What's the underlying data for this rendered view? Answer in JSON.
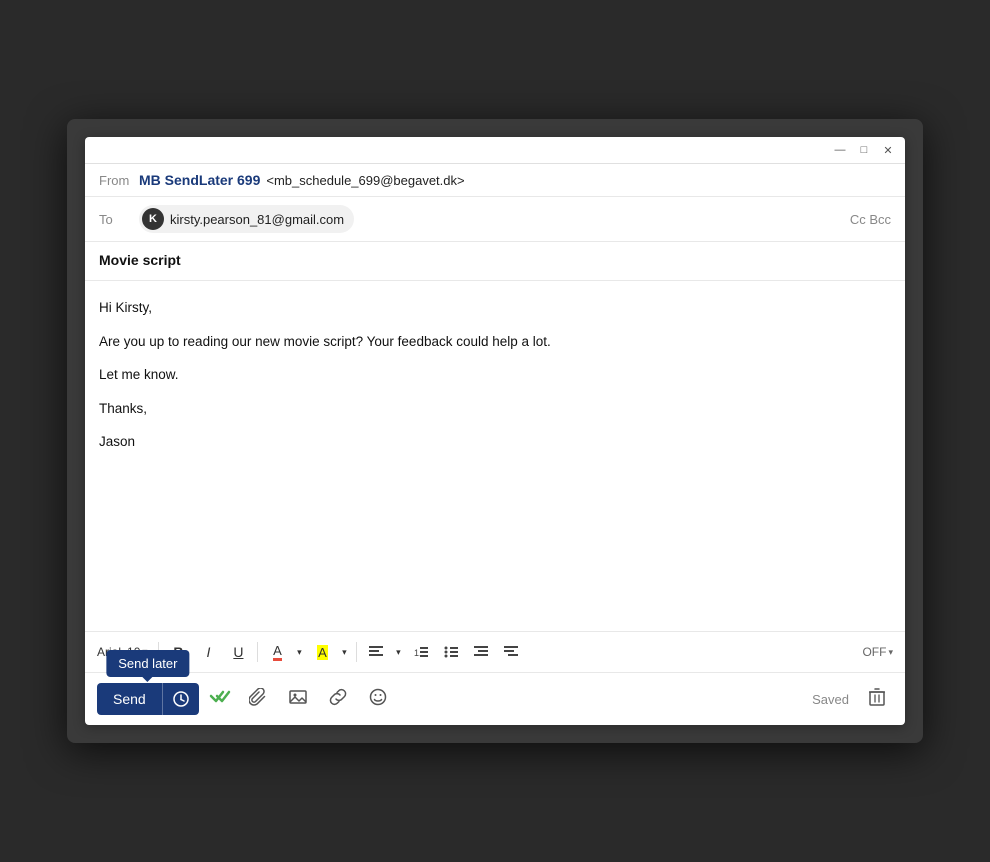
{
  "window": {
    "title_bar": {
      "minimize": "—",
      "maximize": "□",
      "close": "✕"
    }
  },
  "from": {
    "label": "From",
    "sender_name": "MB SendLater 699",
    "sender_email": "<mb_schedule_699@begavet.dk>"
  },
  "to": {
    "label": "To",
    "recipient_initial": "K",
    "recipient_email": "kirsty.pearson_81@gmail.com",
    "cc_bcc": "Cc Bcc"
  },
  "subject": {
    "text": "Movie script"
  },
  "body": {
    "greeting": "Hi Kirsty,",
    "line1": "Are you up to reading our new movie script? Your feedback could help a lot.",
    "line2": "Let me know.",
    "sign_off": "Thanks,",
    "signature": "Jason"
  },
  "toolbar": {
    "font_family": "Arial",
    "font_size": "10",
    "bold": "B",
    "italic": "I",
    "underline": "U",
    "off_label": "OFF"
  },
  "actions": {
    "send_label": "Send",
    "tooltip_label": "Send later",
    "saved_label": "Saved"
  }
}
